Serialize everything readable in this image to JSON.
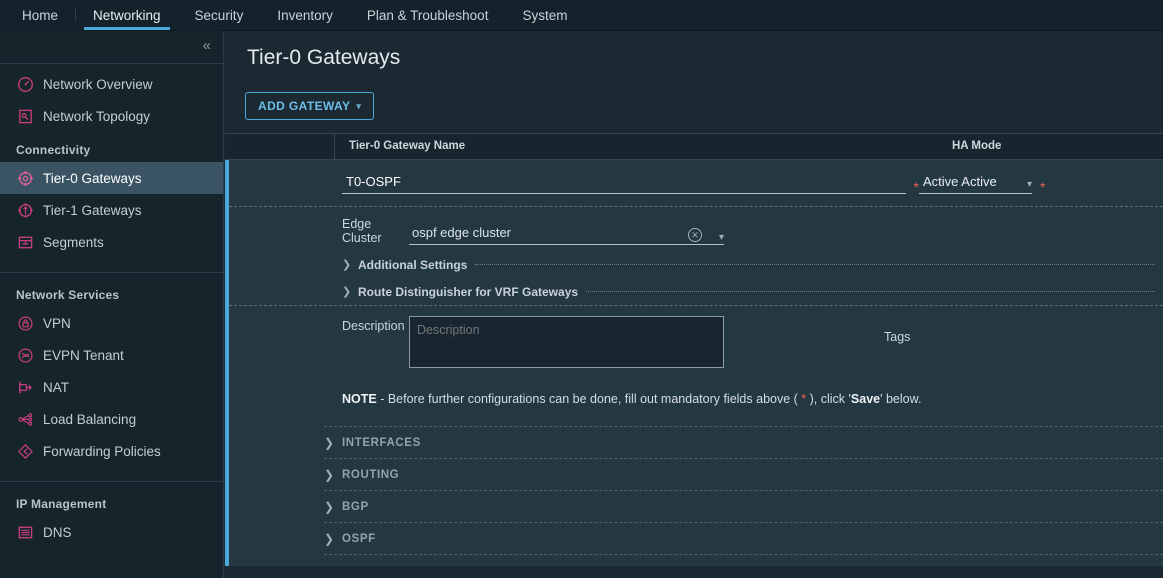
{
  "topnav": {
    "items": [
      {
        "label": "Home",
        "active": false
      },
      {
        "label": "Networking",
        "active": true
      },
      {
        "label": "Security",
        "active": false
      },
      {
        "label": "Inventory",
        "active": false
      },
      {
        "label": "Plan & Troubleshoot",
        "active": false
      },
      {
        "label": "System",
        "active": false
      }
    ]
  },
  "sidebar": {
    "collapse_icon": "double-chevron-left-icon",
    "items": [
      {
        "label": "Network Overview",
        "icon": "gauge-icon",
        "selected": false
      },
      {
        "label": "Network Topology",
        "icon": "topology-icon",
        "selected": false
      }
    ],
    "groups": [
      {
        "title": "Connectivity",
        "items": [
          {
            "label": "Tier-0 Gateways",
            "icon": "tier0-icon",
            "selected": true
          },
          {
            "label": "Tier-1 Gateways",
            "icon": "tier1-icon",
            "selected": false
          },
          {
            "label": "Segments",
            "icon": "segments-icon",
            "selected": false
          }
        ]
      },
      {
        "title": "Network Services",
        "items": [
          {
            "label": "VPN",
            "icon": "vpn-lock-icon",
            "selected": false
          },
          {
            "label": "EVPN Tenant",
            "icon": "evpn-icon",
            "selected": false
          },
          {
            "label": "NAT",
            "icon": "nat-icon",
            "selected": false
          },
          {
            "label": "Load Balancing",
            "icon": "load-balancing-icon",
            "selected": false
          },
          {
            "label": "Forwarding Policies",
            "icon": "forwarding-policies-icon",
            "selected": false
          }
        ]
      },
      {
        "title": "IP Management",
        "items": [
          {
            "label": "DNS",
            "icon": "dns-icon",
            "selected": false
          }
        ]
      }
    ]
  },
  "main": {
    "page_title": "Tier-0 Gateways",
    "add_gateway_label": "ADD GATEWAY",
    "add_gateway_caret": "chevron-down-icon",
    "table": {
      "columns": [
        {
          "key": "name",
          "label": "Tier-0 Gateway Name"
        },
        {
          "key": "ha",
          "label": "HA Mode"
        }
      ]
    },
    "form": {
      "name_value": "T0-OSPF",
      "name_placeholder": "Tier-0 Gateway Name",
      "name_required_mark": "*",
      "ha_mode_value": "Active Active",
      "ha_mode_required_mark": "*",
      "ha_caret": "chevron-down-icon",
      "edge_cluster_label": "Edge Cluster",
      "edge_cluster_value": "ospf edge cluster",
      "edge_cluster_clear_icon": "clear-circle-icon",
      "edge_cluster_caret": "chevron-down-icon",
      "accordions": [
        {
          "label": "Additional Settings",
          "caret": "chevron-right-icon"
        },
        {
          "label": "Route Distinguisher for VRF Gateways",
          "caret": "chevron-right-icon"
        }
      ],
      "description_label": "Description",
      "description_value": "",
      "description_placeholder": "Description",
      "tags_label": "Tags",
      "note_prefix": "NOTE",
      "note_dash": " - ",
      "note_part1": "Before further configurations can be done, fill out mandatory fields above ( ",
      "note_star": "*",
      "note_part2": " ), click '",
      "note_save": "Save",
      "note_part3": "' below."
    },
    "sections": [
      {
        "label": "INTERFACES",
        "caret": "chevron-right-icon"
      },
      {
        "label": "ROUTING",
        "caret": "chevron-right-icon"
      },
      {
        "label": "BGP",
        "caret": "chevron-right-icon"
      },
      {
        "label": "OSPF",
        "caret": "chevron-right-icon"
      }
    ]
  },
  "colors": {
    "accent_blue": "#4aa8d8",
    "sidebar_icon_pink": "#c8407b",
    "required_red": "#e8614d",
    "selected_row_bg": "#3a5463",
    "page_bg": "#1b2a32",
    "panel_bg": "#243841"
  }
}
